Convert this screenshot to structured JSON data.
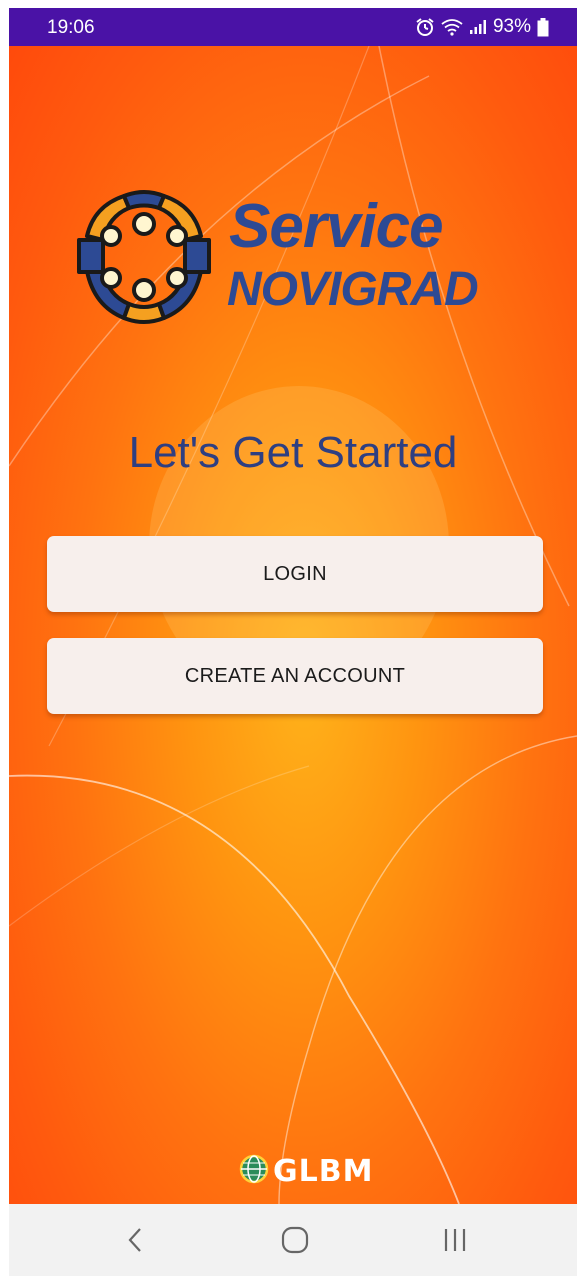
{
  "status_bar": {
    "time": "19:06",
    "battery": "93%",
    "icons": [
      "alarm-icon",
      "wifi-icon",
      "signal-icon",
      "battery-icon"
    ]
  },
  "brand": {
    "line1": "Service",
    "line2": "NOVIGRAD",
    "color": "#2d4a94"
  },
  "headline": "Let's Get Started",
  "buttons": {
    "login": "LOGIN",
    "create_account": "CREATE AN ACCOUNT"
  },
  "footer": {
    "logo_text": "GLBM"
  },
  "nav": {
    "icons": [
      "back-icon",
      "home-icon",
      "recent-apps-icon"
    ]
  },
  "colors": {
    "status_bar": "#4a12a6",
    "background_center": "#ffb21a",
    "background_edge": "#ff4a0c",
    "button_bg": "#f7efec",
    "headline": "#2e3f82"
  }
}
